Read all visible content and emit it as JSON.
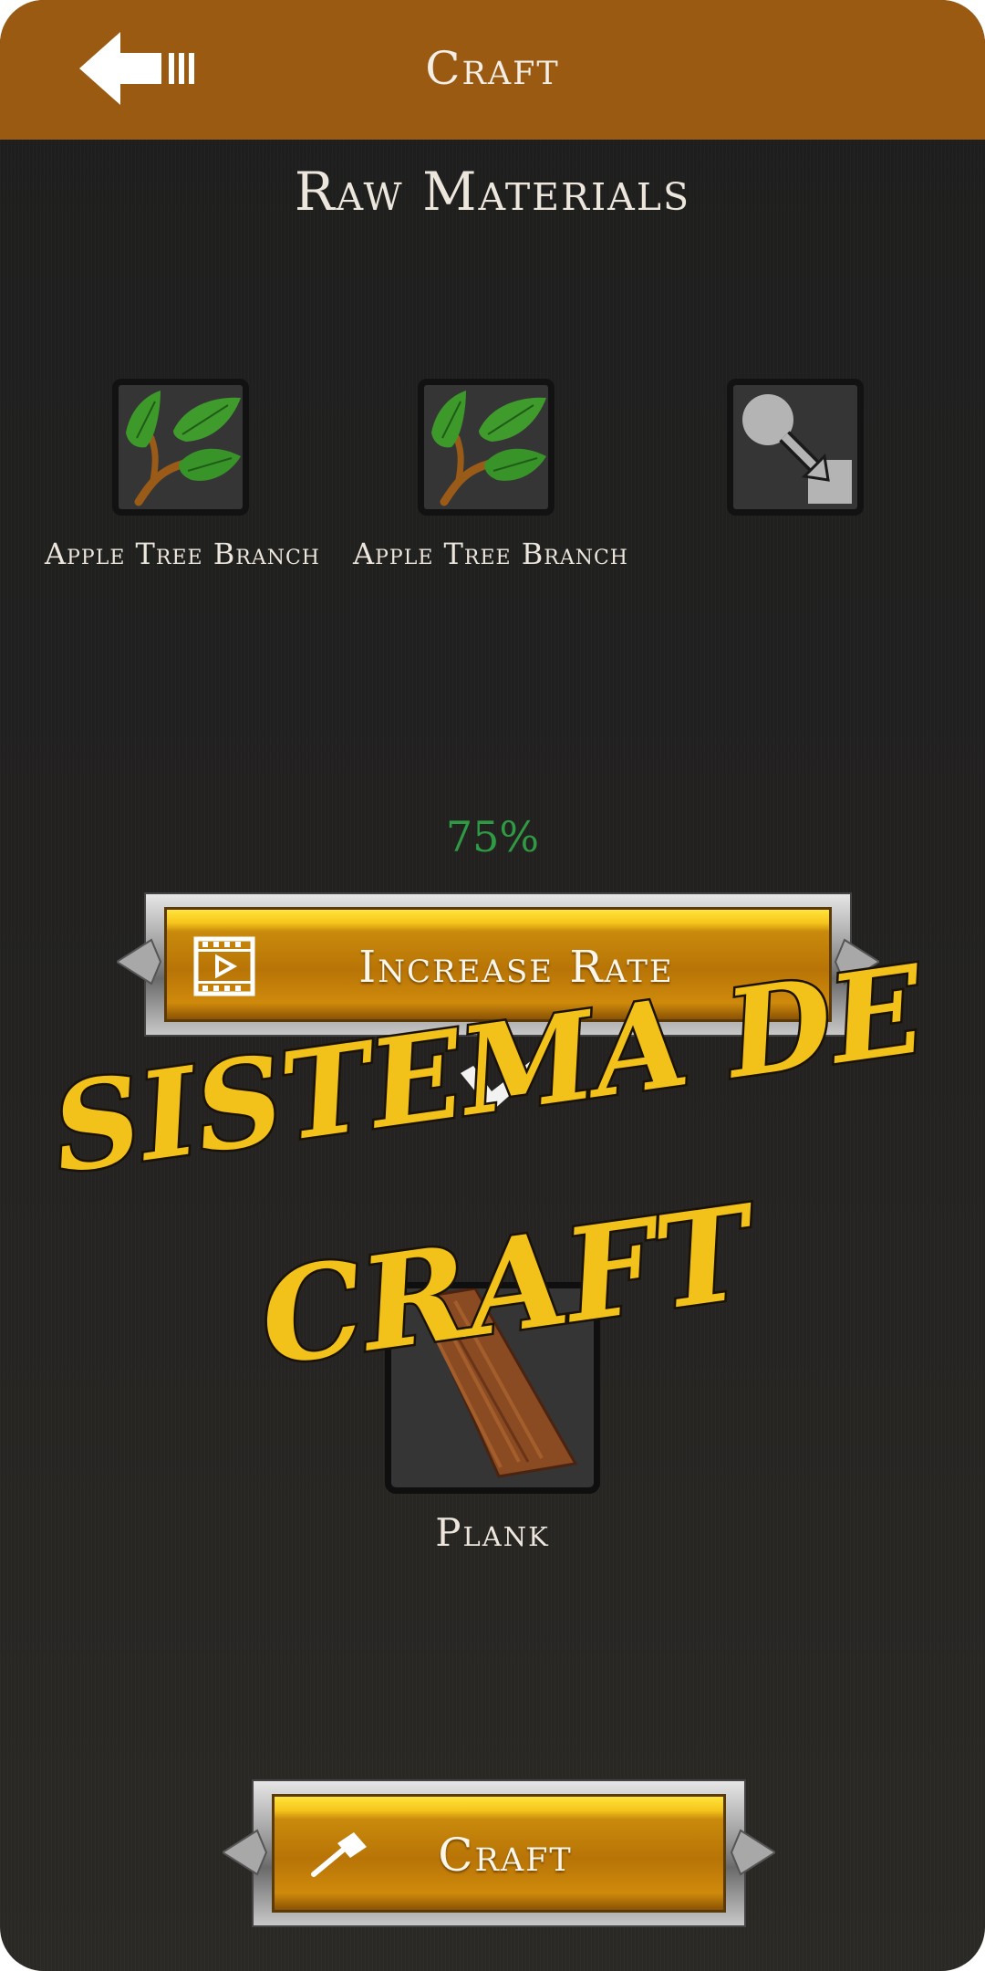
{
  "header": {
    "title": "Craft",
    "back_icon": "back-arrow-icon"
  },
  "raw_materials": {
    "title": "Raw Materials",
    "slots": [
      {
        "label": "Apple Tree Branch",
        "icon": "apple-tree-branch-icon"
      },
      {
        "label": "Apple Tree Branch",
        "icon": "apple-tree-branch-icon"
      },
      {
        "label": "",
        "icon": "transform-placeholder-icon"
      }
    ]
  },
  "rate": {
    "value": "75%"
  },
  "increase_rate_button": {
    "label": "Increase Rate",
    "icon": "video-ad-icon"
  },
  "result": {
    "label": "Plank",
    "icon": "plank-icon"
  },
  "craft_button": {
    "label": "Craft",
    "icon": "hammer-icon"
  },
  "overlay": {
    "line1": "SISTEMA DE",
    "line2": "CRAFT"
  },
  "colors": {
    "header": "#9a5a12",
    "rate": "#2f9a44",
    "gold": "#c98a0c",
    "overlay_text": "#f2c21a"
  }
}
